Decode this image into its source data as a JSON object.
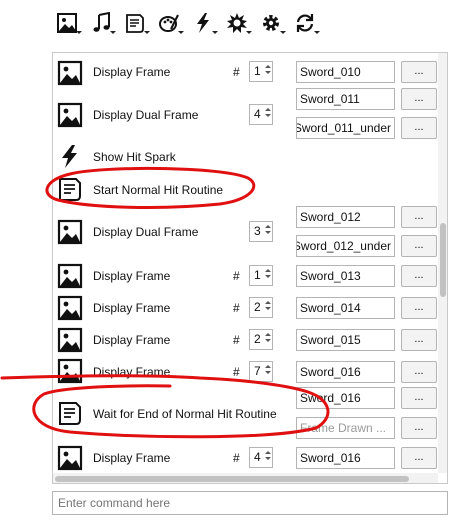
{
  "toolbar": {
    "buttons": [
      {
        "icon": "image-icon"
      },
      {
        "icon": "music-note-icon"
      },
      {
        "icon": "script-icon"
      },
      {
        "icon": "palette-icon"
      },
      {
        "icon": "lightning-icon"
      },
      {
        "icon": "burst-icon"
      },
      {
        "icon": "gear-icon"
      },
      {
        "icon": "refresh-icon"
      }
    ]
  },
  "rows": [
    {
      "label": "Display Frame",
      "hash": "#",
      "num": "1",
      "field": "Sword_010",
      "more": "..."
    },
    {
      "label": "Display Dual Frame",
      "num": "4",
      "field1": "Sword_011",
      "field2": "Sword_011_under",
      "more1": "...",
      "more2": "..."
    },
    {
      "label": "Show Hit Spark"
    },
    {
      "label": "Start Normal Hit Routine"
    },
    {
      "label": "Display Dual Frame",
      "num": "3",
      "field1": "Sword_012",
      "field2": "Sword_012_under",
      "more1": "...",
      "more2": "..."
    },
    {
      "label": "Display Frame",
      "hash": "#",
      "num": "1",
      "field": "Sword_013",
      "more": "..."
    },
    {
      "label": "Display Frame",
      "hash": "#",
      "num": "2",
      "field": "Sword_014",
      "more": "..."
    },
    {
      "label": "Display Frame",
      "hash": "#",
      "num": "2",
      "field": "Sword_015",
      "more": "..."
    },
    {
      "label": "Display Frame",
      "hash": "#",
      "num": "7",
      "field": "Sword_016",
      "more": "..."
    },
    {
      "label": "Wait for End of Normal Hit Routine",
      "field1": "Sword_016",
      "field2": "Frame Drawn ...",
      "more1": "...",
      "more2": "..."
    },
    {
      "label": "Display Frame",
      "hash": "#",
      "num": "4",
      "field": "Sword_016",
      "more": "..."
    }
  ],
  "command": {
    "placeholder": "Enter command here"
  },
  "colors": {
    "annotation_red": "#e01010",
    "panel_border": "#c9c9c9"
  }
}
